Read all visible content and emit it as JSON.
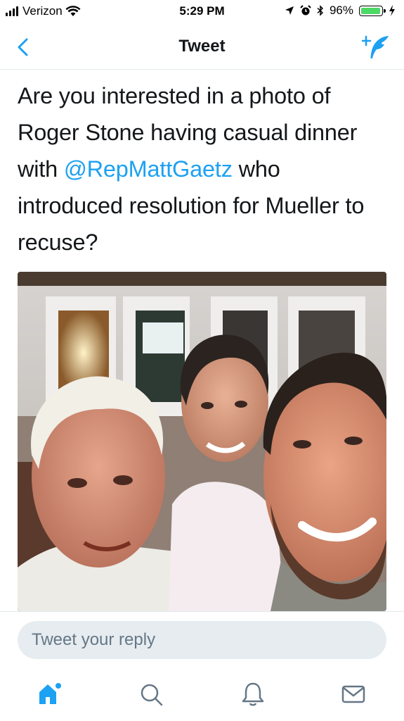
{
  "status_bar": {
    "carrier": "Verizon",
    "time": "5:29 PM",
    "battery_percent": "96%",
    "battery_level": 0.96,
    "icons": [
      "signal-icon",
      "wifi-icon",
      "location-icon",
      "alarm-icon",
      "bluetooth-icon",
      "battery-icon",
      "charging-icon"
    ]
  },
  "nav": {
    "title": "Tweet",
    "back_icon": "chevron-left-icon",
    "compose_icon": "compose-tweet-icon"
  },
  "tweet": {
    "text_before": "Are you interested in a photo of Roger Stone having casual dinner with ",
    "mention": "@RepMattGaetz",
    "text_after": " who introduced resolution for Mueller to recuse?",
    "media_description_icon": "photo-media"
  },
  "reply": {
    "placeholder": "Tweet your reply"
  },
  "tabs": [
    {
      "icon": "home-icon",
      "active": true
    },
    {
      "icon": "search-icon",
      "active": false
    },
    {
      "icon": "notifications-icon",
      "active": false
    },
    {
      "icon": "messages-icon",
      "active": false
    }
  ],
  "colors": {
    "accent": "#1da1f2",
    "text": "#14171a",
    "secondary": "#657786",
    "reply_bg": "#e6ecf0",
    "divider": "#e1e8ed",
    "battery_fill": "#4cd964"
  }
}
